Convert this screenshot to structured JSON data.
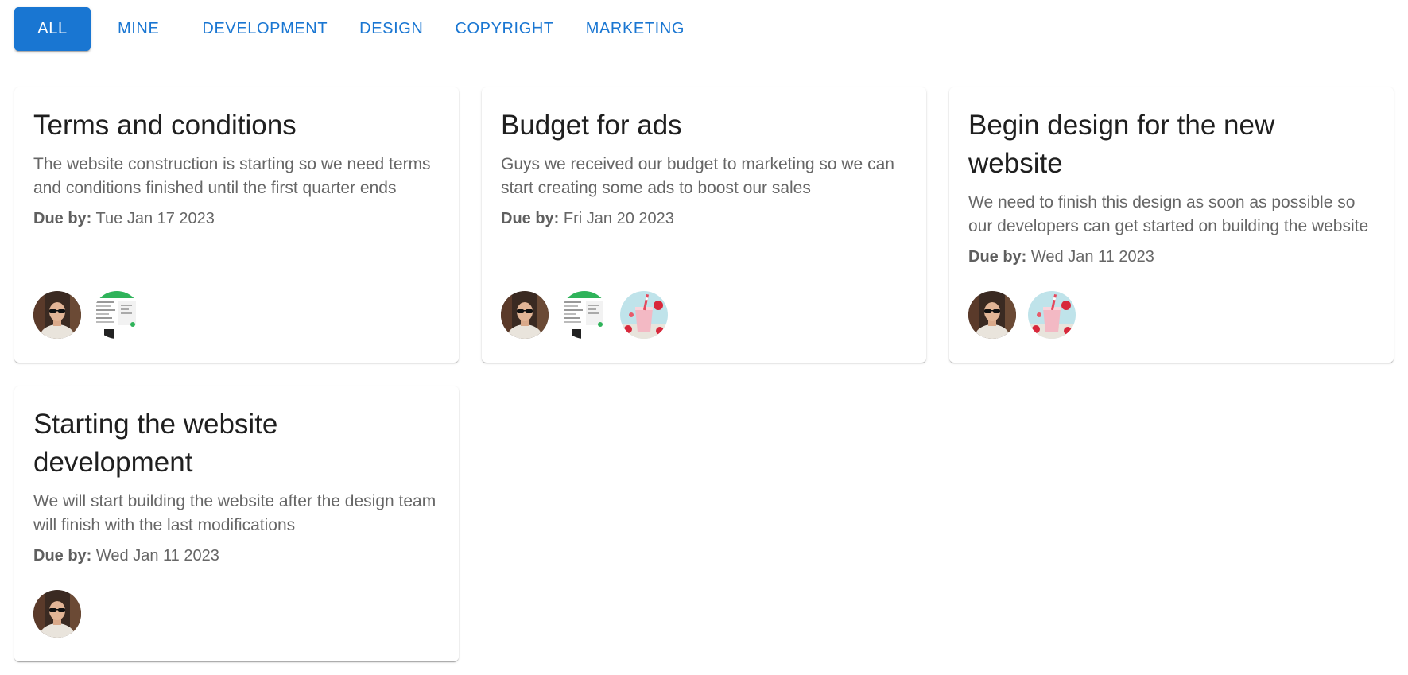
{
  "filters": [
    {
      "label": "ALL",
      "active": true
    },
    {
      "label": "MINE"
    },
    {
      "label": "DEVELOPMENT"
    },
    {
      "label": "DESIGN"
    },
    {
      "label": "COPYRIGHT"
    },
    {
      "label": "MARKETING"
    }
  ],
  "due_label": "Due by:",
  "cards": [
    {
      "title": "Terms and conditions",
      "description": "The website construction is starting so we need terms and conditions finished until the first quarter ends",
      "due_date": "Tue Jan 17 2023",
      "avatars": [
        "person-avatar",
        "screenshot-avatar"
      ]
    },
    {
      "title": "Budget for ads",
      "description": "Guys we received our budget to marketing so we can start creating some ads to boost our sales",
      "due_date": "Fri Jan 20 2023",
      "avatars": [
        "person-avatar",
        "screenshot-avatar",
        "smoothie-avatar"
      ]
    },
    {
      "title": "Begin design for the new website",
      "description": "We need to finish this design as soon as possible so our developers can get started on building the website",
      "due_date": "Wed Jan 11 2023",
      "avatars": [
        "person-avatar",
        "smoothie-avatar"
      ]
    },
    {
      "title": "Starting the website development",
      "description": "We will start building the website after the design team will finish with the last modifications",
      "due_date": "Wed Jan 11 2023",
      "avatars": [
        "person-avatar"
      ]
    }
  ],
  "colors": {
    "primary": "#1976d2",
    "text_secondary": "#666666"
  }
}
